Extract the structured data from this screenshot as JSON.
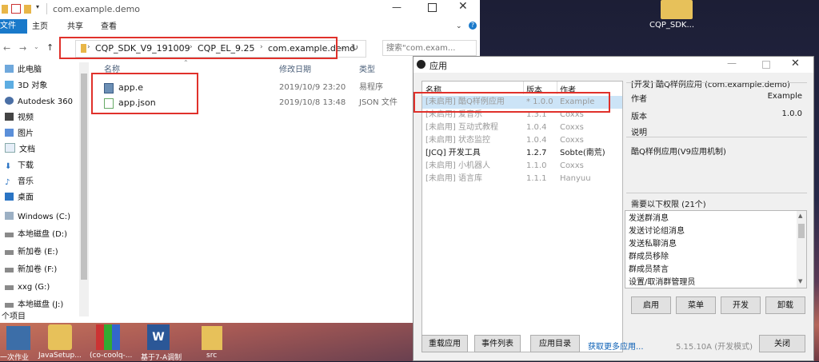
{
  "explorer": {
    "title": "com.example.demo",
    "ribbon_tabs": [
      "文件",
      "主页",
      "共享",
      "查看"
    ],
    "breadcrumb": [
      "CQP_SDK_V9_191009",
      "CQP_EL_9.25",
      "com.example.demo"
    ],
    "search_placeholder": "搜索\"com.exam...",
    "columns": {
      "name": "名称",
      "date": "修改日期",
      "type": "类型"
    },
    "files": [
      {
        "name": "app.e",
        "date": "2019/10/9 23:20",
        "type": "易程序"
      },
      {
        "name": "app.json",
        "date": "2019/10/8 13:48",
        "type": "JSON 文件"
      }
    ],
    "nav": [
      "此电脑",
      "3D 对象",
      "Autodesk 360",
      "视频",
      "图片",
      "文档",
      "下载",
      "音乐",
      "桌面",
      "Windows (C:)",
      "本地磁盘 (D:)",
      "新加卷 (E:)",
      "新加卷 (F:)",
      "xxg (G:)",
      "本地磁盘 (J:)"
    ],
    "status": "个项目"
  },
  "desktop": {
    "icon_label": "CQP_SDK...",
    "taskbar_labels": [
      "一次作业",
      "JavaSetup...",
      "(co-coolq-...",
      "基于7-A调制",
      "src"
    ]
  },
  "dialog": {
    "title": "应用",
    "columns": {
      "name": "名称",
      "version": "版本",
      "author": "作者"
    },
    "apps": [
      {
        "name": "[未启用] 酷Q样例应用",
        "version": "* 1.0.0",
        "author": "Example",
        "enabled": false,
        "selected": true
      },
      {
        "name": "[未启用] 爱音乐",
        "version": "1.3.1",
        "author": "Coxxs",
        "enabled": false
      },
      {
        "name": "[未启用] 互动式教程",
        "version": "1.0.4",
        "author": "Coxxs",
        "enabled": false
      },
      {
        "name": "[未启用] 状态监控",
        "version": "1.0.4",
        "author": "Coxxs",
        "enabled": false
      },
      {
        "name": "[JCQ] 开发工具",
        "version": "1.2.7",
        "author": "Sobte(南荒)",
        "enabled": true
      },
      {
        "name": "[未启用] 小机器人",
        "version": "1.1.0",
        "author": "Coxxs",
        "enabled": false
      },
      {
        "name": "[未启用] 语言库",
        "version": "1.1.1",
        "author": "Hanyuu",
        "enabled": false
      }
    ],
    "detail": {
      "header": "[开发] 酷Q样例应用 (com.example.demo)",
      "author_label": "作者",
      "author_value": "Example",
      "version_label": "版本",
      "version_value": "1.0.0",
      "desc_label": "说明",
      "description": "酷Q样例应用(V9应用机制)",
      "perm_header": "需要以下权限 (21个)",
      "permissions": [
        "发送群消息",
        "发送讨论组消息",
        "发送私聊消息",
        "群成员移除",
        "群成员禁言",
        "设置/取消群管理员"
      ]
    },
    "action_buttons": [
      "启用",
      "菜单",
      "开发",
      "卸载"
    ],
    "bottom_buttons": [
      "重载应用",
      "事件列表",
      "应用目录"
    ],
    "more_link": "获取更多应用...",
    "version_info": "5.15.10A (开发模式)",
    "close_button": "关闭"
  }
}
